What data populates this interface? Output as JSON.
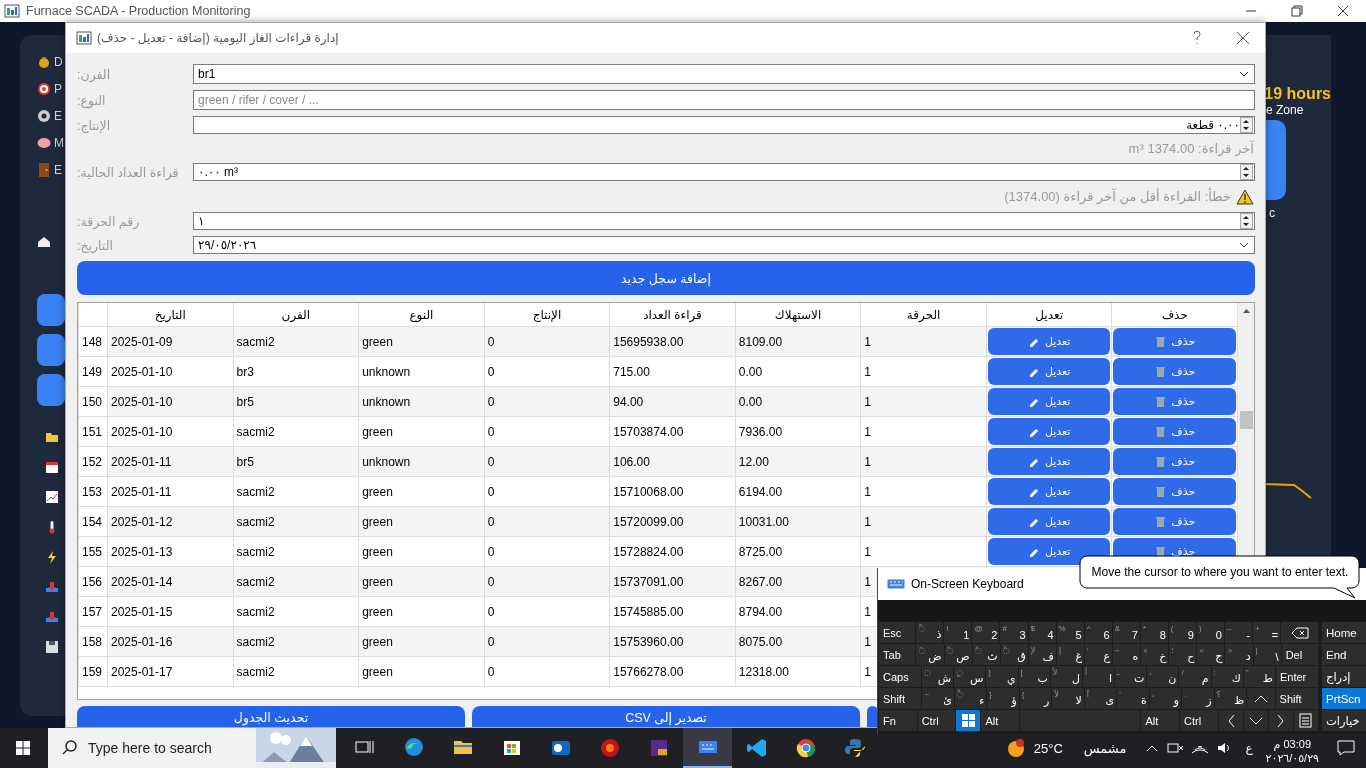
{
  "app_window": {
    "title": "Furnace SCADA - Production Monitoring",
    "sidebar_items": [
      {
        "label": "D"
      },
      {
        "label": "P"
      },
      {
        "label": "E"
      },
      {
        "label": "M"
      },
      {
        "label": "E"
      }
    ],
    "right_panel": {
      "duration": "19 hours",
      "zone": "e Zone",
      "note": "c"
    }
  },
  "dialog": {
    "title": "إدارة قراءات الغاز اليومية (إضافة - تعديل - حذف)",
    "form": [
      {
        "kind": "combo",
        "label": "الفرن:",
        "value": "br1"
      },
      {
        "kind": "text",
        "label": "النوع:",
        "placeholder": "green / rifer / cover / ..."
      },
      {
        "kind": "spin",
        "label": "الإنتاج:",
        "value": "٠.٠٠ قطعة"
      },
      {
        "kind": "info",
        "text": "آخر قراءة: 1374.00 m³"
      },
      {
        "kind": "spin",
        "label": "قراءة العداد الحالية:",
        "value": "٠.٠٠ m³"
      },
      {
        "kind": "warning",
        "text": "خطأ: القراءة أقل من آخر قراءة (1374.00)"
      },
      {
        "kind": "spin",
        "label": "رقم الحرقة:",
        "value": "١"
      },
      {
        "kind": "combo",
        "label": "التاريخ:",
        "value": "٢٩/٠٥/٢٠٢٦"
      }
    ],
    "add_button": "إضافة سجل جديد",
    "table": {
      "columns": [
        "حذف",
        "تعديل",
        "الحرقة",
        "الاستهلاك",
        "قراءة العداد",
        "الإنتاج",
        "النوع",
        "الفرن",
        "التاريخ"
      ],
      "rows": [
        {
          "cells": [
            "حذف",
            "تعديل",
            "1",
            "8109.00",
            "15695938.00",
            "0",
            "green",
            "sacmi2",
            "2025-01-09"
          ],
          "number": "148"
        },
        {
          "cells": [
            "حذف",
            "تعديل",
            "1",
            "0.00",
            "715.00",
            "0",
            "unknown",
            "br3",
            "2025-01-10"
          ],
          "number": "149"
        },
        {
          "cells": [
            "حذف",
            "تعديل",
            "1",
            "0.00",
            "94.00",
            "0",
            "unknown",
            "br5",
            "2025-01-10"
          ],
          "number": "150"
        },
        {
          "cells": [
            "حذف",
            "تعديل",
            "1",
            "7936.00",
            "15703874.00",
            "0",
            "green",
            "sacmi2",
            "2025-01-10"
          ],
          "number": "151"
        },
        {
          "cells": [
            "حذف",
            "تعديل",
            "1",
            "12.00",
            "106.00",
            "0",
            "unknown",
            "br5",
            "2025-01-11"
          ],
          "number": "152"
        },
        {
          "cells": [
            "حذف",
            "تعديل",
            "1",
            "6194.00",
            "15710068.00",
            "0",
            "green",
            "sacmi2",
            "2025-01-11"
          ],
          "number": "153"
        },
        {
          "cells": [
            "حذف",
            "تعديل",
            "1",
            "10031.00",
            "15720099.00",
            "0",
            "green",
            "sacmi2",
            "2025-01-12"
          ],
          "number": "154"
        },
        {
          "cells": [
            "حذف",
            "تعديل",
            "1",
            "8725.00",
            "15728824.00",
            "0",
            "green",
            "sacmi2",
            "2025-01-13"
          ],
          "number": "155"
        },
        {
          "cells": [
            "",
            "",
            "1",
            "8267.00",
            "15737091.00",
            "0",
            "green",
            "sacmi2",
            "2025-01-14"
          ],
          "number": "156"
        },
        {
          "cells": [
            "",
            "",
            "1",
            "8794.00",
            "15745885.00",
            "0",
            "green",
            "sacmi2",
            "2025-01-15"
          ],
          "number": "157"
        },
        {
          "cells": [
            "",
            "",
            "1",
            "8075.00",
            "15753960.00",
            "0",
            "green",
            "sacmi2",
            "2025-01-16"
          ],
          "number": "158"
        },
        {
          "cells": [
            "",
            "",
            "1",
            "12318.00",
            "15766278.00",
            "0",
            "green",
            "sacmi2",
            "2025-01-17"
          ],
          "number": "159"
        }
      ]
    },
    "buttons": [
      "تصدير إلى CSV",
      "تحديث الجدول"
    ]
  },
  "keyboard": {
    "title": "On-Screen Keyboard",
    "rows": [
      {
        "keys": [
          {
            "kind": "backspace"
          },
          {
            "kind": "char",
            "main": "=",
            "shift": "+"
          },
          {
            "kind": "char",
            "main": "-",
            "shift": "–"
          },
          {
            "kind": "char",
            "main": "0",
            "shift": ")"
          },
          {
            "kind": "char",
            "main": "9",
            "shift": "("
          },
          {
            "kind": "char",
            "main": "8",
            "shift": "*"
          },
          {
            "kind": "char",
            "main": "7",
            "shift": "&"
          },
          {
            "kind": "char",
            "main": "6",
            "shift": "^"
          },
          {
            "kind": "char",
            "main": "5",
            "shift": "%"
          },
          {
            "kind": "char",
            "main": "4",
            "shift": "$"
          },
          {
            "kind": "char",
            "main": "3",
            "shift": "#"
          },
          {
            "kind": "char",
            "main": "2",
            "shift": "@"
          },
          {
            "kind": "char",
            "main": "1",
            "shift": "!"
          },
          {
            "kind": "char",
            "main": "ذ",
            "shift": "◌ّ"
          },
          {
            "kind": "mod",
            "label": "Esc"
          }
        ]
      },
      {
        "keys": [
          {
            "kind": "mod",
            "label": "Del"
          },
          {
            "kind": "char",
            "main": "\\",
            "shift": "|"
          },
          {
            "kind": "char",
            "main": "د",
            "shift": ">"
          },
          {
            "kind": "char",
            "main": "ج",
            "shift": "<"
          },
          {
            "kind": "char",
            "main": "ح",
            "shift": "؛"
          },
          {
            "kind": "char",
            "main": "خ",
            "shift": "×"
          },
          {
            "kind": "char",
            "main": "ه",
            "shift": "÷"
          },
          {
            "kind": "char",
            "main": "ع",
            "shift": "‘"
          },
          {
            "kind": "char",
            "main": "غ",
            "shift": "إ"
          },
          {
            "kind": "char",
            "main": "ف",
            "shift": "لإ"
          },
          {
            "kind": "char",
            "main": "ق",
            "shift": "◌ٌ"
          },
          {
            "kind": "char",
            "main": "ث",
            "shift": "◌ُ"
          },
          {
            "kind": "char",
            "main": "ص",
            "shift": "◌ً"
          },
          {
            "kind": "char",
            "main": "ض",
            "shift": "◌َ"
          },
          {
            "kind": "mod",
            "label": "Tab"
          }
        ]
      },
      {
        "keys": [
          {
            "kind": "mod",
            "label": "Enter"
          },
          {
            "kind": "char",
            "main": "ط",
            "shift": "\""
          },
          {
            "kind": "char",
            "main": "ك",
            "shift": ":"
          },
          {
            "kind": "char",
            "main": "م",
            "shift": "/"
          },
          {
            "kind": "char",
            "main": "ن",
            "shift": "،"
          },
          {
            "kind": "char",
            "main": "ت",
            "shift": "ـ"
          },
          {
            "kind": "char",
            "main": "ا",
            "shift": "أ"
          },
          {
            "kind": "char",
            "main": "ل",
            "shift": "لأ"
          },
          {
            "kind": "char",
            "main": "ب",
            "shift": "["
          },
          {
            "kind": "char",
            "main": "ي",
            "shift": "]"
          },
          {
            "kind": "char",
            "main": "س",
            "shift": "◌ٍ"
          },
          {
            "kind": "char",
            "main": "ش",
            "shift": "◌ِ"
          },
          {
            "kind": "mod",
            "label": "Caps"
          }
        ]
      },
      {
        "keys": [
          {
            "kind": "mod",
            "label": "Shift"
          },
          {
            "kind": "up"
          },
          {
            "kind": "char",
            "main": "ظ",
            "shift": "؟"
          },
          {
            "kind": "char",
            "main": "ز",
            "shift": "."
          },
          {
            "kind": "char",
            "main": "و",
            "shift": "،"
          },
          {
            "kind": "char",
            "main": "ة",
            "shift": "'"
          },
          {
            "kind": "char",
            "main": "ى",
            "shift": "آ"
          },
          {
            "kind": "char",
            "main": "لا",
            "shift": "لآ"
          },
          {
            "kind": "char",
            "main": "ر",
            "shift": "{"
          },
          {
            "kind": "char",
            "main": "ؤ",
            "shift": "}"
          },
          {
            "kind": "char",
            "main": "ء",
            "shift": "◌ْ"
          },
          {
            "kind": "char",
            "main": "ئ",
            "shift": "~"
          },
          {
            "kind": "mod",
            "label": "Shift"
          }
        ]
      },
      {
        "keys": [
          {
            "kind": "menu"
          },
          {
            "kind": "right"
          },
          {
            "kind": "down"
          },
          {
            "kind": "left"
          },
          {
            "kind": "mod",
            "label": "Ctrl"
          },
          {
            "kind": "mod",
            "label": "Alt"
          },
          {
            "kind": "space"
          },
          {
            "kind": "mod",
            "label": "Alt"
          },
          {
            "kind": "windows"
          },
          {
            "kind": "mod",
            "label": "Ctrl"
          },
          {
            "kind": "mod",
            "label": "Fn"
          }
        ]
      }
    ],
    "side_keys": [
      {
        "label": "Home",
        "selected": false
      },
      {
        "label": "End",
        "selected": false
      },
      {
        "label": "إدراج",
        "selected": false
      },
      {
        "label": "PrtScn",
        "selected": true
      },
      {
        "label": "خيارات",
        "selected": false
      }
    ]
  },
  "tooltip": "Move the cursor to where you want to enter text.",
  "taskbar": {
    "search_placeholder": "Type here to search",
    "apps": [
      {
        "selected": false
      },
      {
        "selected": false
      },
      {
        "selected": false
      },
      {
        "selected": false
      },
      {
        "selected": false
      },
      {
        "selected": false
      },
      {
        "selected": false
      },
      {
        "selected": true
      },
      {
        "selected": false
      },
      {
        "selected": false
      },
      {
        "selected": false
      }
    ],
    "temperature": "25°C",
    "weather": "مشمس",
    "language": "ع",
    "time": "03:09 م",
    "date": "٢٠٢٦/٠٥/٢٩"
  }
}
